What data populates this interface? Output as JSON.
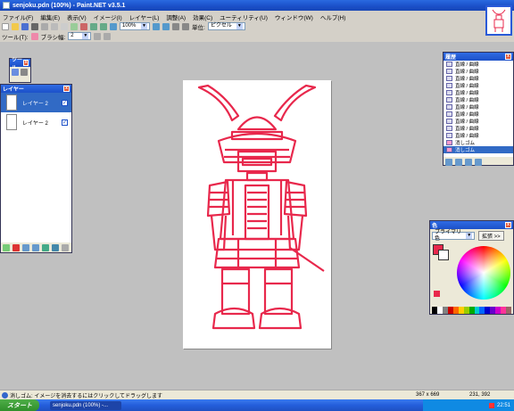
{
  "window": {
    "title": "senjoku.pdn (100%) - Paint.NET v3.5.1"
  },
  "menu": [
    "ファイル(F)",
    "編集(E)",
    "表示(V)",
    "イメージ(I)",
    "レイヤー(L)",
    "調整(A)",
    "効果(C)",
    "ユーティリティ(U)",
    "ウィンドウ(W)",
    "ヘルプ(H)"
  ],
  "toolbar": {
    "zoom": "100%",
    "units_label": "単位:",
    "units": "ピクセル",
    "tool_label": "ツール(T):",
    "brush_label": "ブラシ幅:",
    "brush_width": "2"
  },
  "tools_panel": {
    "title": "ツール"
  },
  "layers_panel": {
    "title": "レイヤー",
    "layers": [
      {
        "name": "レイヤー 2",
        "checked": true
      },
      {
        "name": "レイヤー 2",
        "checked": true
      }
    ]
  },
  "history_panel": {
    "title": "履歴",
    "items": [
      "直線 / 曲線",
      "直線 / 曲線",
      "直線 / 曲線",
      "直線 / 曲線",
      "直線 / 曲線",
      "直線 / 曲線",
      "直線 / 曲線",
      "直線 / 曲線",
      "直線 / 曲線",
      "直線 / 曲線",
      "直線 / 曲線",
      "消しゴム",
      "消しゴム"
    ]
  },
  "colors_panel": {
    "title": "色",
    "mode": "プライマリ色",
    "more_button": "拡張 >>",
    "primary_color": "#e8284c",
    "secondary_color": "#ffffff"
  },
  "status": {
    "message": "消しゴム: イメージを消去するにはクリックしてドラッグします",
    "image_size": "367 x 669",
    "cursor": "231, 392"
  },
  "taskbar": {
    "start": "スタート",
    "task": "senjoku.pdn (100%) -...",
    "time": "22:51"
  }
}
